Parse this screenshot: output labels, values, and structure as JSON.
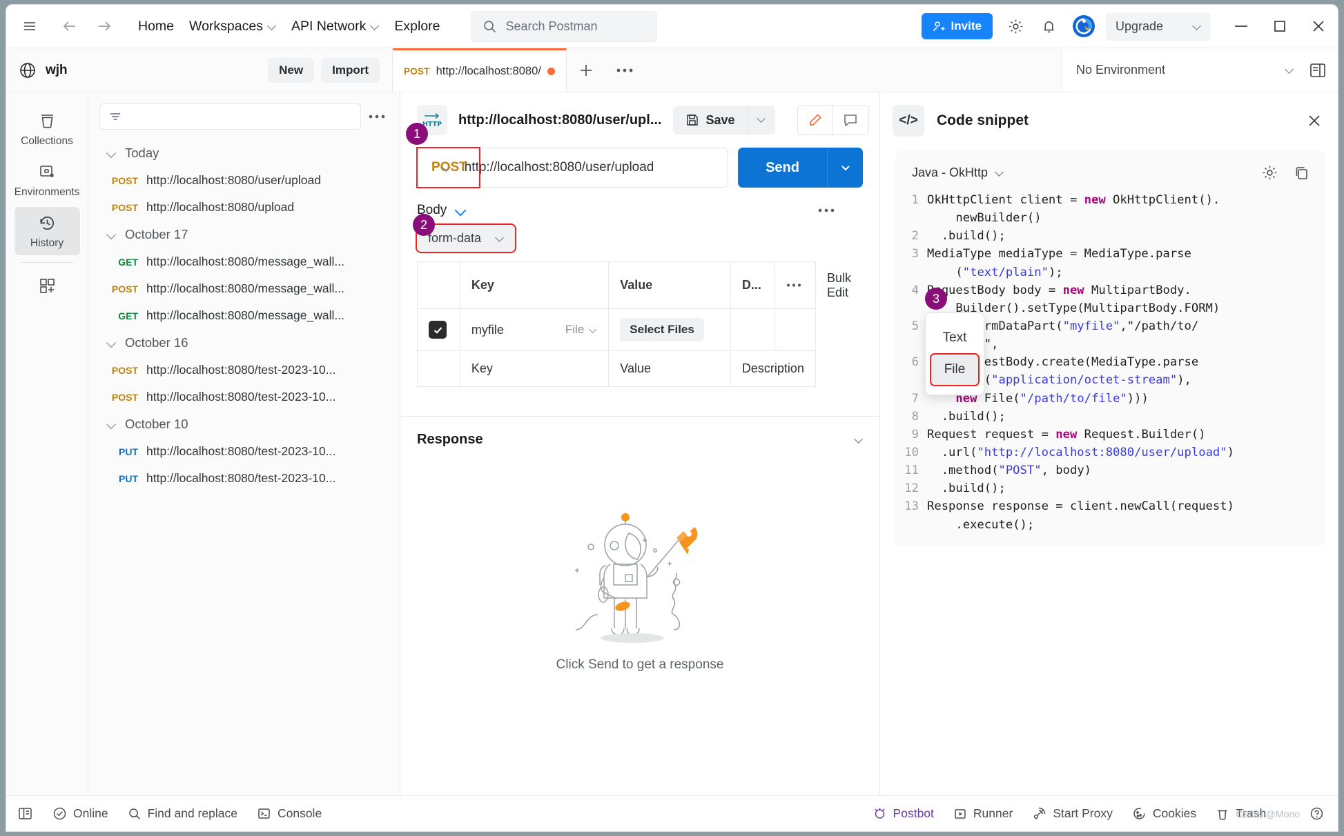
{
  "topbar": {
    "menu_icon": "hamburger-icon",
    "back_icon": "arrow-left-icon",
    "forward_icon": "arrow-right-icon",
    "links": [
      {
        "label": "Home",
        "caret": false
      },
      {
        "label": "Workspaces",
        "caret": true
      },
      {
        "label": "API Network",
        "caret": true
      },
      {
        "label": "Explore",
        "caret": false
      }
    ],
    "search_placeholder": "Search Postman",
    "invite_label": "Invite",
    "settings_icon": "gear-icon",
    "notification_icon": "bell-icon",
    "avatar_icon": "user-avatar",
    "upgrade_label": "Upgrade",
    "minimize_icon": "minimize-icon",
    "maximize_icon": "maximize-icon",
    "close_icon": "close-icon"
  },
  "workspace": {
    "globe_icon": "globe-icon",
    "name": "wjh",
    "new_label": "New",
    "import_label": "Import"
  },
  "tabs": {
    "open": [
      {
        "method": "POST",
        "url": "http://localhost:8080/",
        "unsaved": true
      }
    ],
    "add_icon": "plus-icon",
    "more_icon": "more-horizontal-icon"
  },
  "environment": {
    "selected": "No Environment",
    "caret_icon": "chevron-down-icon",
    "eye_icon": "environment-quick-look-icon"
  },
  "rail": {
    "items": [
      {
        "label": "Collections",
        "icon": "collections-icon",
        "active": false
      },
      {
        "label": "Environments",
        "icon": "environments-icon",
        "active": false
      },
      {
        "label": "History",
        "icon": "history-icon",
        "active": true
      }
    ],
    "add_label": "",
    "add_icon": "add-module-icon"
  },
  "history": {
    "filter_icon": "filter-icon",
    "filter_placeholder": "",
    "more_icon": "more-horizontal-icon",
    "groups": [
      {
        "label": "Today",
        "items": [
          {
            "method": "POST",
            "url": "http://localhost:8080/user/upload"
          },
          {
            "method": "POST",
            "url": "http://localhost:8080/upload"
          }
        ]
      },
      {
        "label": "October 17",
        "items": [
          {
            "method": "GET",
            "url": "http://localhost:8080/message_wall..."
          },
          {
            "method": "POST",
            "url": "http://localhost:8080/message_wall..."
          },
          {
            "method": "GET",
            "url": "http://localhost:8080/message_wall..."
          }
        ]
      },
      {
        "label": "October 16",
        "items": [
          {
            "method": "POST",
            "url": "http://localhost:8080/test-2023-10..."
          },
          {
            "method": "POST",
            "url": "http://localhost:8080/test-2023-10..."
          }
        ]
      },
      {
        "label": "October 10",
        "items": [
          {
            "method": "PUT",
            "url": "http://localhost:8080/test-2023-10..."
          },
          {
            "method": "PUT",
            "url": "http://localhost:8080/test-2023-10..."
          }
        ]
      }
    ]
  },
  "request": {
    "protocol_badge": "HTTP",
    "title": "http://localhost:8080/user/upl...",
    "save_label": "Save",
    "save_caret_icon": "chevron-down-icon",
    "edit_icon": "pencil-icon",
    "comment_icon": "comment-icon",
    "method": "POST",
    "method_caret_icon": "chevron-down-icon",
    "url": "http://localhost:8080/user/upload",
    "send_label": "Send",
    "send_caret_icon": "chevron-down-icon"
  },
  "body": {
    "label": "Body",
    "caret_icon": "chevron-down-icon",
    "more_icon": "more-horizontal-icon",
    "mode": "form-data",
    "mode_caret_icon": "chevron-down-icon",
    "columns": [
      "",
      "Key",
      "Value",
      "D...",
      "",
      "Bulk Edit"
    ],
    "bulk_edit_label": "Bulk Edit",
    "dots_icon": "more-horizontal-icon",
    "rows": [
      {
        "checked": true,
        "key": "myfile",
        "type": "File",
        "type_caret_icon": "chevron-down-icon",
        "value_button": "Select Files",
        "description": ""
      }
    ],
    "empty_row": {
      "key_placeholder": "Key",
      "value_placeholder": "Value",
      "description_placeholder": "Description"
    },
    "type_menu": {
      "options": [
        "Text",
        "File"
      ],
      "selected": "File"
    }
  },
  "steps": [
    {
      "number": "1"
    },
    {
      "number": "2"
    },
    {
      "number": "3"
    }
  ],
  "response": {
    "title": "Response",
    "collapse_icon": "chevron-down-icon",
    "empty_hint": "Click Send to get a response",
    "illustration": "astronaut-rocket-illustration"
  },
  "code_snippet": {
    "panel_icon": "code-icon",
    "title": "Code snippet",
    "close_icon": "close-icon",
    "language": "Java - OkHttp",
    "language_caret_icon": "chevron-down-icon",
    "settings_icon": "gear-icon",
    "copy_icon": "copy-icon",
    "lines": [
      {
        "n": "1",
        "code": "OkHttpClient client = new OkHttpClient()."
      },
      {
        "n": "",
        "code": "    newBuilder()"
      },
      {
        "n": "2",
        "code": "  .build();"
      },
      {
        "n": "3",
        "code": "MediaType mediaType = MediaType.parse"
      },
      {
        "n": "",
        "code": "    (\"text/plain\");"
      },
      {
        "n": "4",
        "code": "RequestBody body = new MultipartBody."
      },
      {
        "n": "",
        "code": "    Builder().setType(MultipartBody.FORM)"
      },
      {
        "n": "5",
        "code": "  .addFormDataPart(\"myfile\",\"/path/to/"
      },
      {
        "n": "",
        "code": "    file\","
      },
      {
        "n": "6",
        "code": "    RequestBody.create(MediaType.parse"
      },
      {
        "n": "",
        "code": "        (\"application/octet-stream\"),"
      },
      {
        "n": "7",
        "code": "    new File(\"/path/to/file\")))"
      },
      {
        "n": "8",
        "code": "  .build();"
      },
      {
        "n": "9",
        "code": "Request request = new Request.Builder()"
      },
      {
        "n": "10",
        "code": "  .url(\"http://localhost:8080/user/upload\")"
      },
      {
        "n": "11",
        "code": "  .method(\"POST\", body)"
      },
      {
        "n": "12",
        "code": "  .build();"
      },
      {
        "n": "13",
        "code": "Response response = client.newCall(request)"
      },
      {
        "n": "",
        "code": "    .execute();"
      }
    ]
  },
  "statusbar": {
    "left": [
      {
        "label": "",
        "icon": "sidebar-toggle-icon"
      },
      {
        "label": "Online",
        "icon": "check-circle-icon"
      },
      {
        "label": "Find and replace",
        "icon": "search-icon"
      },
      {
        "label": "Console",
        "icon": "terminal-icon"
      }
    ],
    "right": [
      {
        "label": "Postbot",
        "icon": "postbot-icon"
      },
      {
        "label": "Runner",
        "icon": "play-icon"
      },
      {
        "label": "Start Proxy",
        "icon": "proxy-icon"
      },
      {
        "label": "Cookies",
        "icon": "cookie-icon"
      },
      {
        "label": "Trash",
        "icon": "trash-icon"
      },
      {
        "label": "",
        "icon": "help-icon"
      }
    ],
    "watermark": "CSDN @Mono"
  },
  "colors": {
    "accent_orange": "#ff6c37",
    "primary_blue": "#0b74d4",
    "invite_blue": "#1783ff",
    "method_post": "#c2820b",
    "method_get": "#0a8a3c",
    "method_put": "#0b72c4",
    "highlight_red": "#f32121",
    "step_purple": "#8a0e7a"
  }
}
